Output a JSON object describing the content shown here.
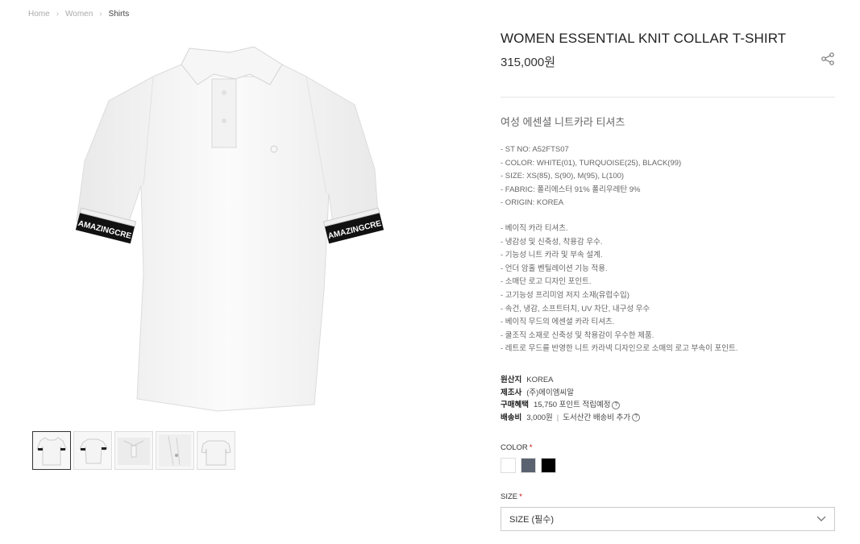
{
  "breadcrumb": {
    "home": "Home",
    "women": "Women",
    "current": "Shirts"
  },
  "product": {
    "title": "WOMEN ESSENTIAL KNIT COLLAR T-SHIRT",
    "price": "315,000원",
    "subtitle": "여성 에센셜 니트카라 티셔츠",
    "cuff_text": "AMAZINGCRE",
    "specs": [
      "- ST NO: A52FTS07",
      "- COLOR: WHITE(01), TURQUOISE(25), BLACK(99)",
      "- SIZE: XS(85), S(90), M(95), L(100)",
      "- FABRIC: 폴리에스터 91% 폴리우레탄 9%",
      "- ORIGIN: KOREA"
    ],
    "features": [
      "- 베이직 카라 티셔츠.",
      "- 냉감성 및 신축성, 착용감 우수.",
      "- 기능성 니트 카라 및 부속 설계.",
      "- 언더 암홀 벤틸레이션 기능 적용.",
      "- 소매단 로고 디자인 포인트.",
      "- 고기능성 프리미엄 저지 소재(유럽수입)",
      "- 속건, 냉감, 소프트터치, UV 차단, 내구성 우수",
      "- 베이직 무드의 에센셜 카라 티셔츠.",
      "- 쿨조직 소재로 신축성 및 착용감이 우수한 제품.",
      "- 레트로 무드를 반영한 니트 카라넥 디자인으로 소매의 로고 부속이 포인트."
    ]
  },
  "meta": {
    "origin_label": "원산지",
    "origin_value": "KOREA",
    "maker_label": "제조사",
    "maker_value": "(주)에이엠씨알",
    "benefit_label": "구매혜택",
    "benefit_value": "15,750 포인트 적립예정",
    "shipping_label": "배송비",
    "shipping_value": "3,000원",
    "shipping_extra": "도서산간 배송비 추가"
  },
  "options": {
    "color_label": "COLOR",
    "required_mark": "*",
    "colors": [
      "#ffffff",
      "#5a6270",
      "#000000"
    ],
    "size_label": "SIZE",
    "size_placeholder": "SIZE (필수)"
  },
  "icons": {
    "share": "share-icon",
    "chevron": "chevron-down-icon",
    "help": "help-icon"
  }
}
